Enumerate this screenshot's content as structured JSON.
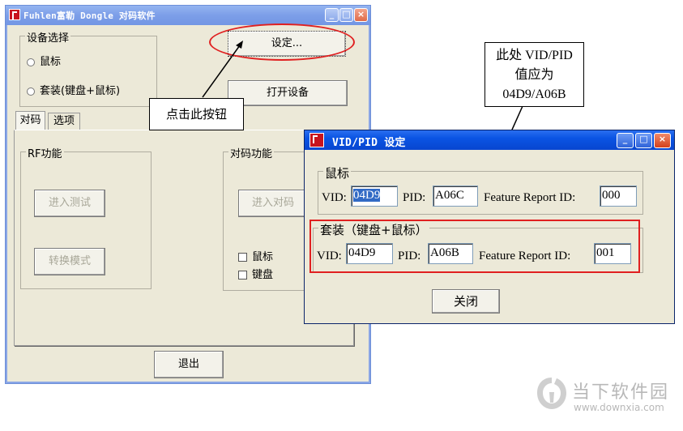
{
  "main_window": {
    "title": "Fuhlen富勒 Dongle 对码软件",
    "device_group": {
      "title": "设备选择",
      "option_mouse": "鼠标",
      "option_combo": "套装(键盘+鼠标)"
    },
    "settings_button": "设定...",
    "open_device_button": "打开设备",
    "tabs": [
      "对码",
      "选项"
    ],
    "rf_group": {
      "title": "RF功能",
      "enter_test": "进入测试",
      "switch_mode": "转换模式"
    },
    "pair_group": {
      "title": "对码功能",
      "enter_pair": "进入对码",
      "check_mouse": "鼠标",
      "check_keyboard": "键盘"
    },
    "exit_button": "退出"
  },
  "dialog": {
    "title": "VID/PID 设定",
    "mouse_group": {
      "title": "鼠标",
      "vid_label": "VID:",
      "vid_value": "04D9",
      "pid_label": "PID:",
      "pid_value": "A06C",
      "feature_label": "Feature Report ID:",
      "feature_value": "000"
    },
    "combo_group": {
      "title": "套装（键盘+鼠标）",
      "vid_label": "VID:",
      "vid_value": "04D9",
      "pid_label": "PID:",
      "pid_value": "A06B",
      "feature_label": "Feature Report ID:",
      "feature_value": "001"
    },
    "close_button": "关闭"
  },
  "annotations": {
    "click_button_note": "点击此按钮",
    "vidpid_note_line1": "此处 VID/PID",
    "vidpid_note_line2": "值应为",
    "vidpid_note_line3": "04D9/A06B"
  },
  "watermark": {
    "brand": "当下软件园",
    "url": "www.downxia.com"
  },
  "colors": {
    "highlight_red": "#e02020",
    "title_blue": "#0a54e3",
    "window_bg": "#ece9d8"
  }
}
